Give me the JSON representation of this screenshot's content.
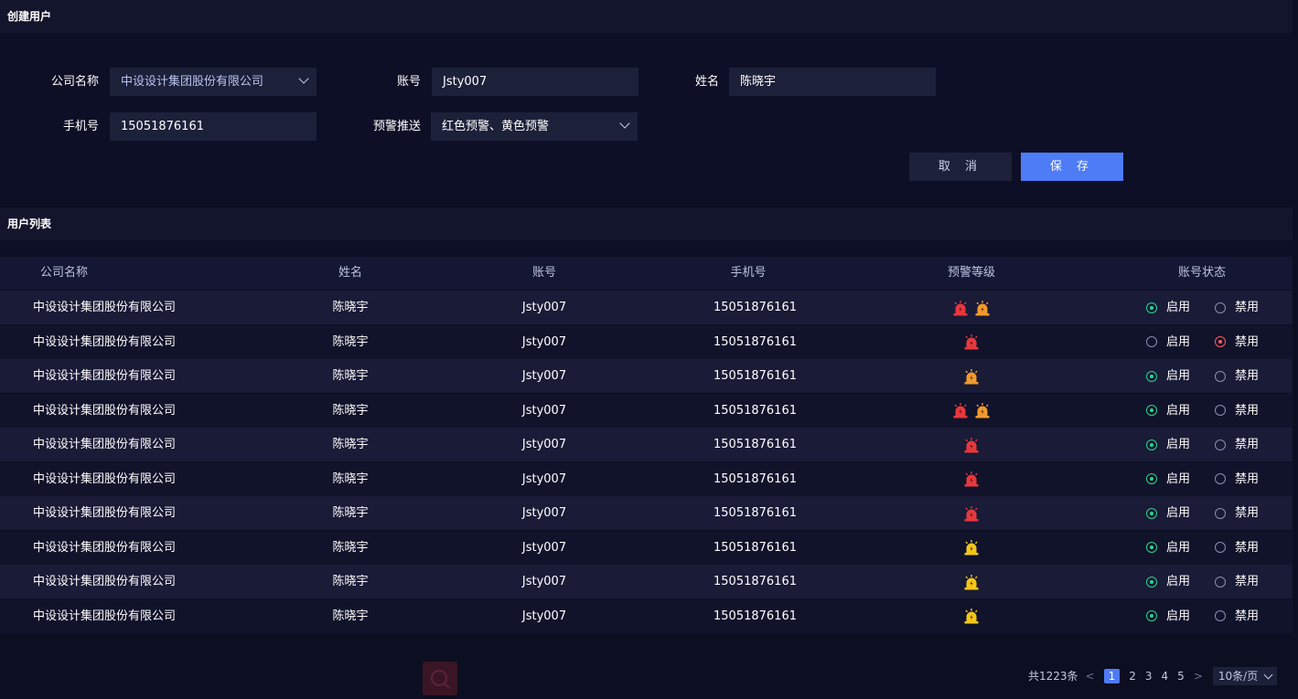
{
  "create": {
    "title": "创建用户",
    "company_label": "公司名称",
    "company_value": "中设设计集团股份有限公司",
    "account_label": "账号",
    "account_value": "Jsty007",
    "name_label": "姓名",
    "name_value": "陈晓宇",
    "phone_label": "手机号",
    "phone_value": "15051876161",
    "alert_label": "预警推送",
    "alert_value": "红色预警、黄色预警",
    "cancel_label": "取 消",
    "save_label": "保 存"
  },
  "list": {
    "title": "用户列表",
    "columns": [
      "公司名称",
      "姓名",
      "账号",
      "手机号",
      "预警等级",
      "账号状态"
    ],
    "enable_label": "启用",
    "disable_label": "禁用",
    "rows": [
      {
        "company": "中设设计集团股份有限公司",
        "name": "陈晓宇",
        "account": "Jsty007",
        "phone": "15051876161",
        "levels": [
          "red",
          "orange"
        ],
        "status": "enabled"
      },
      {
        "company": "中设设计集团股份有限公司",
        "name": "陈晓宇",
        "account": "Jsty007",
        "phone": "15051876161",
        "levels": [
          "red"
        ],
        "status": "disabled"
      },
      {
        "company": "中设设计集团股份有限公司",
        "name": "陈晓宇",
        "account": "Jsty007",
        "phone": "15051876161",
        "levels": [
          "orange"
        ],
        "status": "enabled"
      },
      {
        "company": "中设设计集团股份有限公司",
        "name": "陈晓宇",
        "account": "Jsty007",
        "phone": "15051876161",
        "levels": [
          "red",
          "orange"
        ],
        "status": "enabled"
      },
      {
        "company": "中设设计集团股份有限公司",
        "name": "陈晓宇",
        "account": "Jsty007",
        "phone": "15051876161",
        "levels": [
          "red"
        ],
        "status": "enabled"
      },
      {
        "company": "中设设计集团股份有限公司",
        "name": "陈晓宇",
        "account": "Jsty007",
        "phone": "15051876161",
        "levels": [
          "red"
        ],
        "status": "enabled"
      },
      {
        "company": "中设设计集团股份有限公司",
        "name": "陈晓宇",
        "account": "Jsty007",
        "phone": "15051876161",
        "levels": [
          "red"
        ],
        "status": "enabled"
      },
      {
        "company": "中设设计集团股份有限公司",
        "name": "陈晓宇",
        "account": "Jsty007",
        "phone": "15051876161",
        "levels": [
          "yellow"
        ],
        "status": "enabled"
      },
      {
        "company": "中设设计集团股份有限公司",
        "name": "陈晓宇",
        "account": "Jsty007",
        "phone": "15051876161",
        "levels": [
          "yellow"
        ],
        "status": "enabled"
      },
      {
        "company": "中设设计集团股份有限公司",
        "name": "陈晓宇",
        "account": "Jsty007",
        "phone": "15051876161",
        "levels": [
          "yellow"
        ],
        "status": "enabled"
      }
    ]
  },
  "pagination": {
    "total_text": "共1223条",
    "prev": "<",
    "next": ">",
    "pages": [
      "1",
      "2",
      "3",
      "4",
      "5"
    ],
    "current": "1",
    "page_size": "10条/页"
  },
  "colors": {
    "accent": "#4e7bf6",
    "alarm_red": "#e8383d",
    "alarm_orange": "#f29a2e",
    "alarm_yellow": "#f5c518",
    "status_on": "#2bd58a",
    "status_off_selected": "#ff5b5b"
  }
}
